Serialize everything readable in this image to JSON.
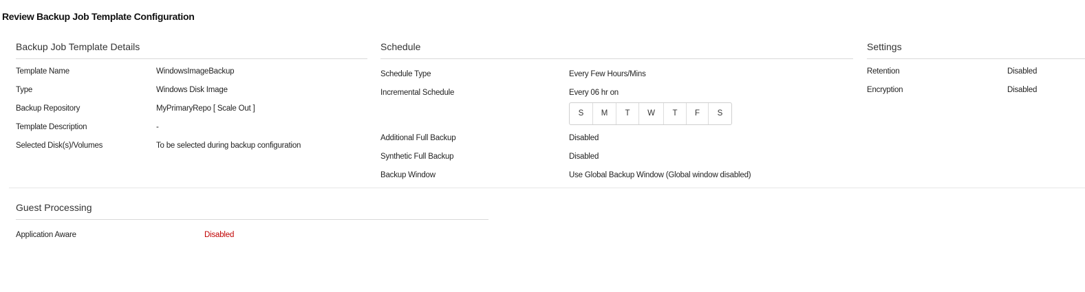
{
  "page": {
    "title": "Review Backup Job Template Configuration"
  },
  "details": {
    "title": "Backup Job Template Details",
    "rows": [
      {
        "label": "Template Name",
        "value": "WindowsImageBackup"
      },
      {
        "label": "Type",
        "value": "Windows Disk Image"
      },
      {
        "label": "Backup Repository",
        "value": "MyPrimaryRepo [ Scale Out ]"
      },
      {
        "label": "Template Description",
        "value": "-"
      },
      {
        "label": "Selected Disk(s)/Volumes",
        "value": "To be selected during backup configuration"
      }
    ]
  },
  "schedule": {
    "title": "Schedule",
    "type_label": "Schedule Type",
    "type_value": "Every Few Hours/Mins",
    "incremental_label": "Incremental Schedule",
    "incremental_value": "Every 06 hr on",
    "days": [
      "S",
      "M",
      "T",
      "W",
      "T",
      "F",
      "S"
    ],
    "additional_full_label": "Additional Full Backup",
    "additional_full_value": "Disabled",
    "synthetic_full_label": "Synthetic Full Backup",
    "synthetic_full_value": "Disabled",
    "window_label": "Backup Window",
    "window_value": "Use Global Backup Window (Global window disabled)"
  },
  "settings": {
    "title": "Settings",
    "retention_label": "Retention",
    "retention_value": "Disabled",
    "encryption_label": "Encryption",
    "encryption_value": "Disabled"
  },
  "guest": {
    "title": "Guest Processing",
    "app_aware_label": "Application Aware",
    "app_aware_value": "Disabled",
    "app_aware_color": "#c00000"
  }
}
